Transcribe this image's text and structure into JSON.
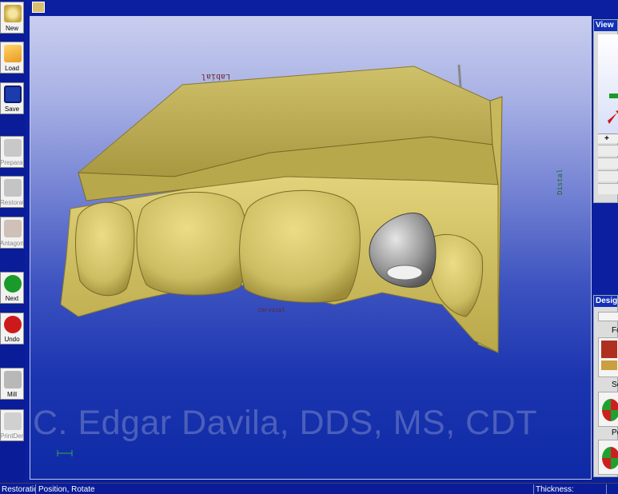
{
  "toolbar": {
    "new_label": "New",
    "load_label": "Load",
    "save_label": "Save",
    "preparation_label": "Preparation",
    "restoration_label": "Restoration",
    "antagonist_label": "Antagonist",
    "next_label": "Next",
    "undo_label": "Undo",
    "mill_label": "Mill",
    "printdentist_label": "PrintDent"
  },
  "viewport": {
    "labial_label": "Labial",
    "distal_label": "Distal",
    "cervical_label": "Cervical",
    "watermark": "C. Edgar Davila, DDS, MS, CDT"
  },
  "view_panel": {
    "title": "View",
    "zoom_in": "+"
  },
  "design_panel": {
    "title": "Design",
    "form_label": "Form",
    "scale_label": "Scale",
    "position_label": "Position"
  },
  "statusbar": {
    "mode": "Restoration",
    "hint": "Position, Rotate",
    "thickness_label": "Thickness:"
  },
  "colors": {
    "stone": "#d4c46a",
    "restoration": "#9a9a9a",
    "accent": "#1230b8"
  }
}
